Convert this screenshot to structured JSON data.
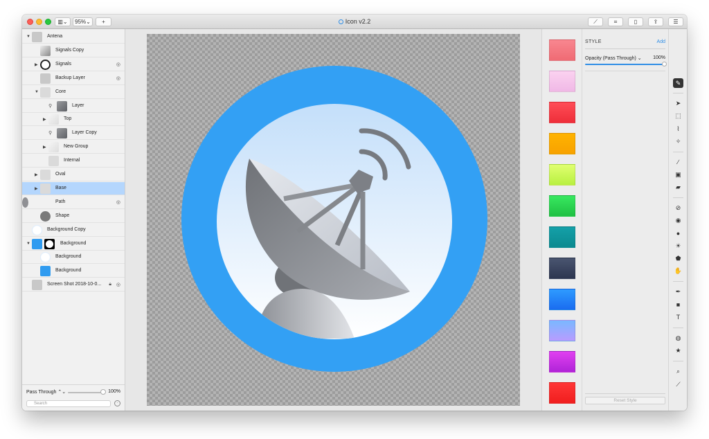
{
  "window": {
    "title": "Icon v2.2",
    "zoom": "95%",
    "add_label": "+"
  },
  "layers": [
    {
      "label": "Antena",
      "depth": 0,
      "expanded": true,
      "thumb": "antenna"
    },
    {
      "label": "Signals Copy",
      "depth": 1,
      "thumb": "signal"
    },
    {
      "label": "Signals",
      "depth": 1,
      "collapsed": true,
      "thumb": "rings",
      "hidden": true
    },
    {
      "label": "Backup Layer",
      "depth": 1,
      "thumb": "antenna",
      "hidden": true
    },
    {
      "label": "Core",
      "depth": 1,
      "expanded": true,
      "thumb": "blank"
    },
    {
      "label": "Layer",
      "depth": 2,
      "thumb": "dish",
      "masked": true
    },
    {
      "label": "Top",
      "depth": 2,
      "collapsed": true,
      "thumb": "light"
    },
    {
      "label": "Layer Copy",
      "depth": 2,
      "thumb": "dish",
      "masked": true
    },
    {
      "label": "New Group",
      "depth": 2,
      "collapsed": true,
      "thumb": "light"
    },
    {
      "label": "Internal",
      "depth": 2,
      "thumb": "blank"
    },
    {
      "label": "Oval",
      "depth": 1,
      "collapsed": true,
      "thumb": "blank"
    },
    {
      "label": "Base",
      "depth": 1,
      "collapsed": true,
      "thumb": "blank",
      "selected": true
    },
    {
      "label": "Path",
      "depth": 1,
      "thumb": "path",
      "hidden": true
    },
    {
      "label": "Shape",
      "depth": 1,
      "thumb": "shape"
    },
    {
      "label": "Background Copy",
      "depth": 0,
      "thumb": "white-circle"
    },
    {
      "label": "Background",
      "depth": 0,
      "expanded": true,
      "thumb": "blue-mask"
    },
    {
      "label": "Background",
      "depth": 1,
      "thumb": "white-circle"
    },
    {
      "label": "Background",
      "depth": 1,
      "thumb": "blue"
    },
    {
      "label": "Screen Shot 2018-10-0...",
      "depth": 0,
      "thumb": "antenna",
      "locked": true,
      "hidden": true
    }
  ],
  "layers_footer": {
    "blend_mode": "Pass Through",
    "opacity": "100%",
    "search_placeholder": "Search"
  },
  "swatches": [
    {
      "name": "pink-red",
      "top": "#f8868f",
      "bottom": "#f06b74"
    },
    {
      "name": "light-pink",
      "top": "#fbd2f0",
      "bottom": "#f0b8e6"
    },
    {
      "name": "red",
      "top": "#ff4d57",
      "bottom": "#ee2e3a"
    },
    {
      "name": "orange",
      "top": "#ffb300",
      "bottom": "#f8a200"
    },
    {
      "name": "lime",
      "top": "#e0ff70",
      "bottom": "#b8f040"
    },
    {
      "name": "green",
      "top": "#38e860",
      "bottom": "#1fc043"
    },
    {
      "name": "teal",
      "top": "#14a0a8",
      "bottom": "#0b8a90"
    },
    {
      "name": "navy",
      "top": "#4a5570",
      "bottom": "#2d3650"
    },
    {
      "name": "blue",
      "top": "#2e9bff",
      "bottom": "#1a6cf0"
    },
    {
      "name": "lavender-blue",
      "top": "#7ab8ff",
      "bottom": "#b89cff"
    },
    {
      "name": "magenta",
      "top": "#e040f0",
      "bottom": "#b024d8"
    },
    {
      "name": "bright-red",
      "top": "#ff3636",
      "bottom": "#f01e1e"
    }
  ],
  "style_panel": {
    "header": "STYLE",
    "add_label": "Add",
    "opacity_label": "Opacity (Pass Through) ⌄",
    "opacity_value": "100%",
    "reset_label": "Reset Style"
  },
  "tools": [
    {
      "name": "style-brush-icon",
      "glyph": "✎",
      "active": true
    },
    {
      "name": "pointer-icon",
      "glyph": "➤"
    },
    {
      "name": "marquee-icon",
      "glyph": "⬚"
    },
    {
      "name": "lasso-icon",
      "glyph": "⌇"
    },
    {
      "name": "magic-wand-icon",
      "glyph": "✧"
    },
    {
      "name": "brush-icon",
      "glyph": "∕"
    },
    {
      "name": "bucket-icon",
      "glyph": "▣"
    },
    {
      "name": "eraser-icon",
      "glyph": "▰"
    },
    {
      "name": "bandage-icon",
      "glyph": "⊘"
    },
    {
      "name": "clone-icon",
      "glyph": "◉"
    },
    {
      "name": "blur-icon",
      "glyph": "●"
    },
    {
      "name": "sun-icon",
      "glyph": "☀"
    },
    {
      "name": "smudge-icon",
      "glyph": "⬟"
    },
    {
      "name": "hand-icon",
      "glyph": "✋"
    },
    {
      "name": "pen-icon",
      "glyph": "✒"
    },
    {
      "name": "rectangle-icon",
      "glyph": "■"
    },
    {
      "name": "text-icon",
      "glyph": "T"
    },
    {
      "name": "shapes-icon",
      "glyph": "◍"
    },
    {
      "name": "star-icon",
      "glyph": "★"
    },
    {
      "name": "zoom-icon",
      "glyph": "⌕"
    },
    {
      "name": "eyedropper-icon",
      "glyph": "⟋"
    }
  ],
  "colors": {
    "accent": "#2f8ee6",
    "icon_ring": "#33a0f4",
    "selection": "#b4d6fd"
  }
}
